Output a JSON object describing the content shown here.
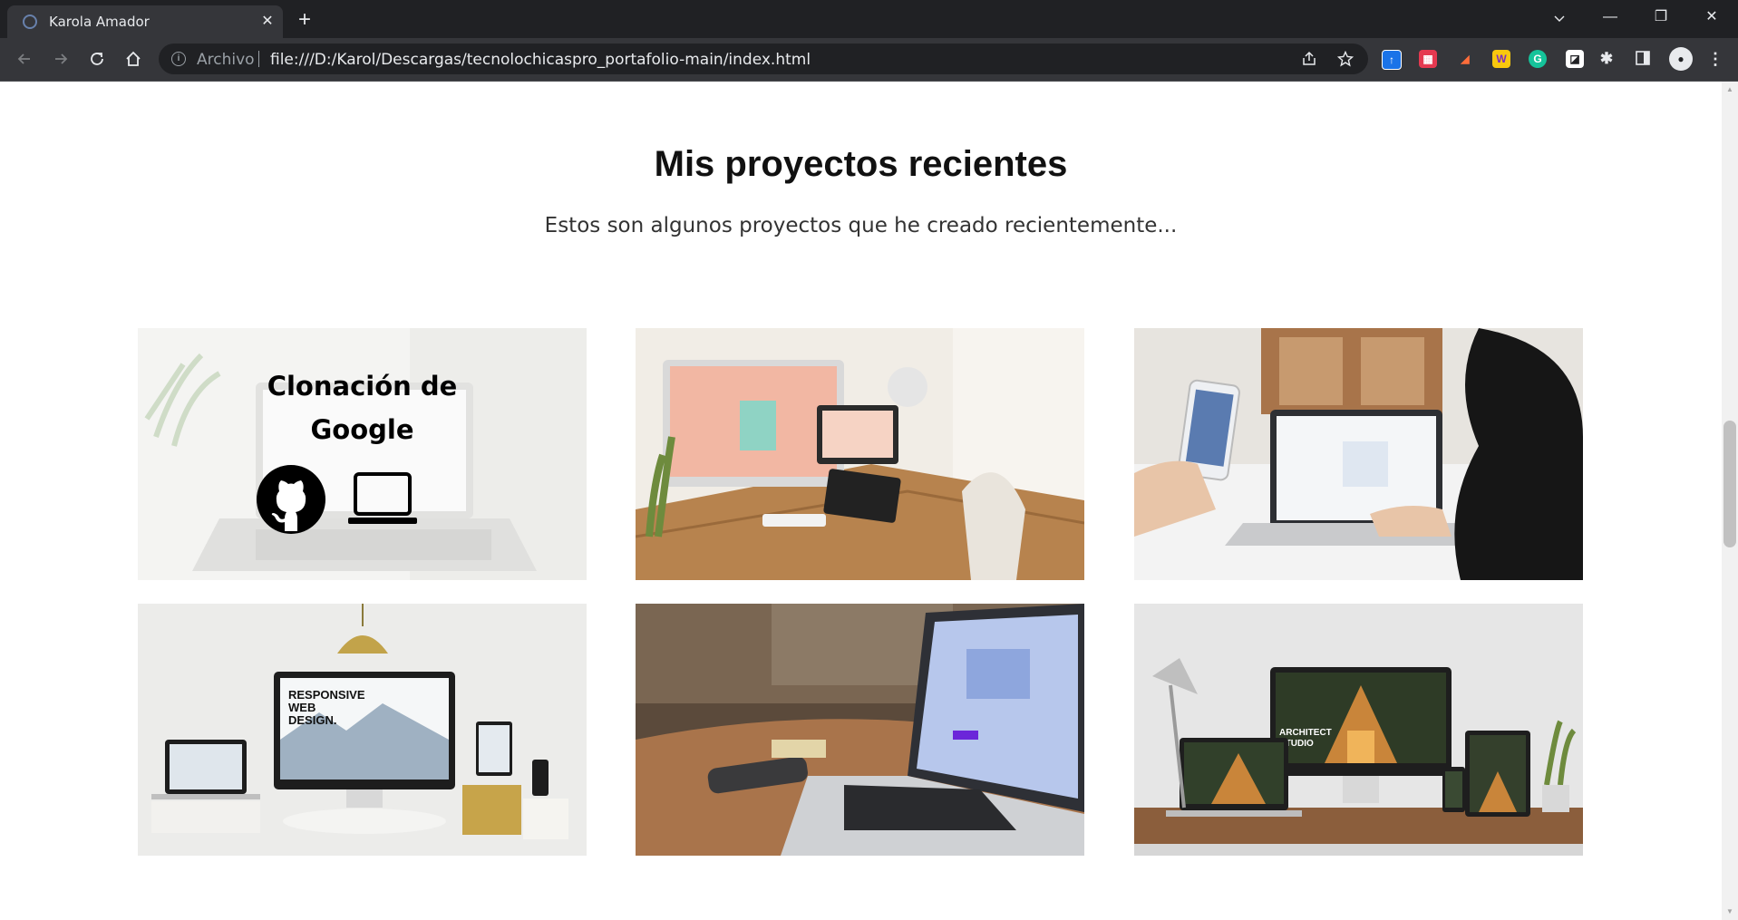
{
  "browser": {
    "tab_title": "Karola Amador",
    "tab_close": "✕",
    "new_tab": "+",
    "address_security_label": "Archivo",
    "url": "file:///D:/Karol/Descargas/tecnolochicaspro_portafolio-main/index.html",
    "controls": {
      "minimize": "—",
      "restore": "❐",
      "close": "✕",
      "tab_search": "⌄"
    }
  },
  "section": {
    "title": "Mis proyectos recientes",
    "subtitle": "Estos son algunos proyectos que he creado recientemente..."
  },
  "projects": [
    {
      "overlay_line1": "Clonación de",
      "overlay_line2": "Google",
      "image": "laptop-google-clone",
      "links": [
        "github-icon",
        "laptop-icon"
      ]
    },
    {
      "image": "desk-with-computers"
    },
    {
      "image": "hands-phone-laptop"
    },
    {
      "image": "responsive-web-design-devices",
      "image_caption": [
        "RESPONSIVE",
        "WEB",
        "DESIGN."
      ]
    },
    {
      "image": "laptop-on-wooden-table"
    },
    {
      "image": "architect-studio-devices",
      "image_caption": [
        "ARCHITECT",
        "STUDIO"
      ]
    }
  ],
  "colors": {
    "chrome_dark": "#202124",
    "chrome_tab": "#35363a",
    "text_primary": "#111111"
  }
}
